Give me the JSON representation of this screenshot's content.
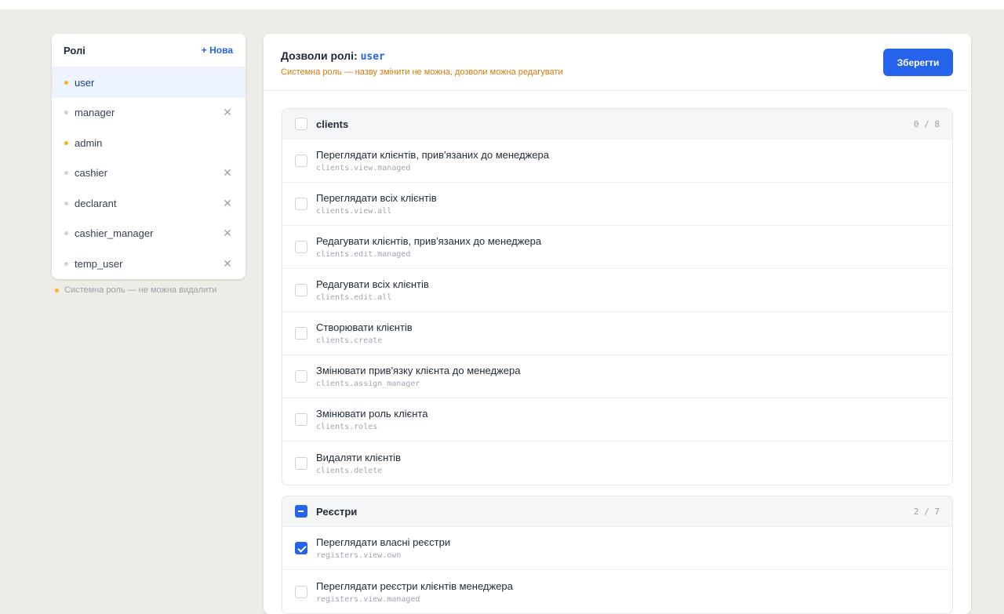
{
  "sidebar": {
    "title": "Ролі",
    "new_label": "+ Нова",
    "roles": [
      {
        "name": "user",
        "system": true,
        "active": true,
        "deletable": false
      },
      {
        "name": "manager",
        "system": false,
        "active": false,
        "deletable": true
      },
      {
        "name": "admin",
        "system": true,
        "active": false,
        "deletable": false
      },
      {
        "name": "cashier",
        "system": false,
        "active": false,
        "deletable": true
      },
      {
        "name": "declarant",
        "system": false,
        "active": false,
        "deletable": true
      },
      {
        "name": "cashier_manager",
        "system": false,
        "active": false,
        "deletable": true
      },
      {
        "name": "temp_user",
        "system": false,
        "active": false,
        "deletable": true
      }
    ],
    "delete_glyph": "✕",
    "legend": "Системна роль — не можна видалити"
  },
  "main": {
    "title_prefix": "Дозволи ролі:",
    "role_code": "user",
    "subtitle": "Системна роль — назву змінити не можна, дозволи можна редагувати",
    "save_label": "Зберегти",
    "groups": [
      {
        "name": "clients",
        "count": "0 / 8",
        "state": "unchecked",
        "permissions": [
          {
            "label": "Переглядати клієнтів, прив'язаних до менеджера",
            "code": "clients.view.managed",
            "checked": false
          },
          {
            "label": "Переглядати всіх клієнтів",
            "code": "clients.view.all",
            "checked": false
          },
          {
            "label": "Редагувати клієнтів, прив'язаних до менеджера",
            "code": "clients.edit.managed",
            "checked": false
          },
          {
            "label": "Редагувати всіх клієнтів",
            "code": "clients.edit.all",
            "checked": false
          },
          {
            "label": "Створювати клієнтів",
            "code": "clients.create",
            "checked": false
          },
          {
            "label": "Змінювати прив'язку клієнта до менеджера",
            "code": "clients.assign_manager",
            "checked": false
          },
          {
            "label": "Змінювати роль клієнта",
            "code": "clients.roles",
            "checked": false
          },
          {
            "label": "Видаляти клієнтів",
            "code": "clients.delete",
            "checked": false
          }
        ]
      },
      {
        "name": "Реєстри",
        "count": "2 / 7",
        "state": "partial",
        "permissions": [
          {
            "label": "Переглядати власні реєстри",
            "code": "registers.view.own",
            "checked": true
          },
          {
            "label": "Переглядати реєстри клієнтів менеджера",
            "code": "registers.view.managed",
            "checked": false
          }
        ]
      }
    ]
  },
  "colors": {
    "accent": "#2563eb",
    "system_dot": "#f5b51a",
    "subtitle": "#d97706",
    "background": "#edece6"
  }
}
